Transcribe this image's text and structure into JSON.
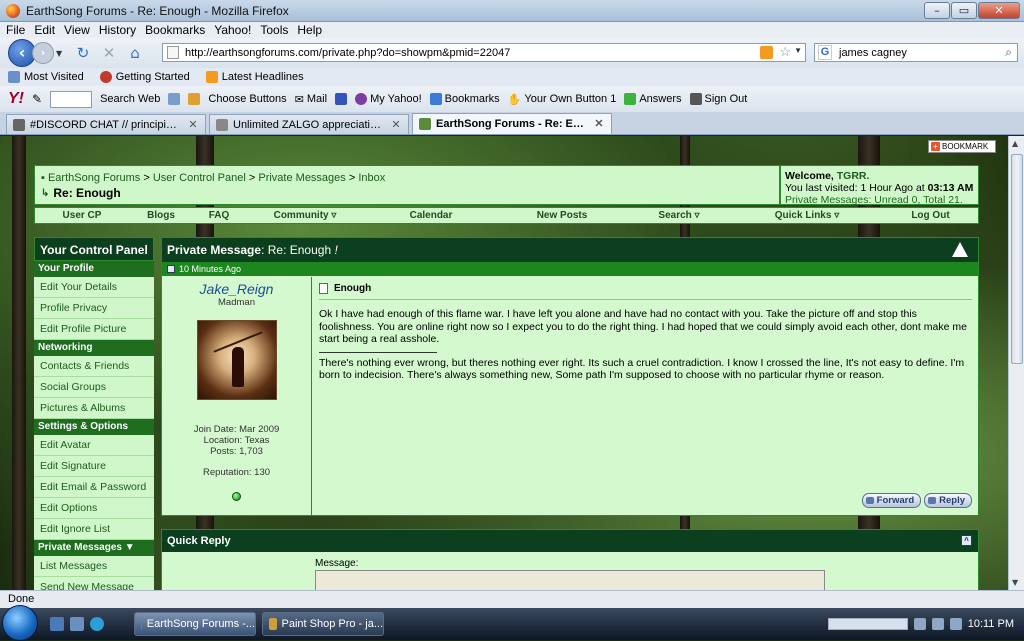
{
  "window": {
    "title": "EarthSong Forums - Re: Enough - Mozilla Firefox"
  },
  "menu": [
    "File",
    "Edit",
    "View",
    "History",
    "Bookmarks",
    "Yahoo!",
    "Tools",
    "Help"
  ],
  "nav": {
    "url": "http://earthsongforums.com/private.php?do=showpm&pmid=22047",
    "search_value": "james cagney"
  },
  "bookmarks": [
    "Most Visited",
    "Getting Started",
    "Latest Headlines"
  ],
  "yahoo_toolbar": [
    "Search Web",
    "Choose Buttons",
    "Mail",
    "My Yahoo!",
    "Bookmarks",
    "Your Own Button 1",
    "Answers",
    "Sign Out"
  ],
  "tabs": [
    {
      "label": "#DISCORD CHAT // principiadiscor..."
    },
    {
      "label": "Unlimited ZALGO appreciation thre..."
    },
    {
      "label": "EarthSong Forums - Re: Enough"
    }
  ],
  "page": {
    "bookmark_btn": "BOOKMARK",
    "crumbs": [
      "EarthSong Forums",
      "User Control Panel",
      "Private Messages",
      "Inbox"
    ],
    "crumb_sep": ">",
    "page_title": "Re: Enough",
    "welcome": {
      "prefix": "Welcome,",
      "user": "TGRR.",
      "visited": "You last visited: 1 Hour Ago at",
      "visited_time": "03:13 AM",
      "pm": "Private Messages: Unread 0, Total 21."
    },
    "navlinks": [
      "User CP",
      "Blogs",
      "FAQ",
      "Community",
      "Calendar",
      "New Posts",
      "Search",
      "Quick Links",
      "Log Out"
    ],
    "sidebar": {
      "title": "Your Control Panel",
      "sections": [
        {
          "name": "Your Profile",
          "items": [
            "Edit Your Details",
            "Profile Privacy",
            "Edit Profile Picture"
          ]
        },
        {
          "name": "Networking",
          "items": [
            "Contacts & Friends",
            "Social Groups",
            "Pictures & Albums"
          ]
        },
        {
          "name": "Settings & Options",
          "items": [
            "Edit Avatar",
            "Edit Signature",
            "Edit Email & Password",
            "Edit Options",
            "Edit Ignore List"
          ]
        },
        {
          "name": "Private Messages",
          "items": [
            "List Messages",
            "Send New Message"
          ]
        }
      ]
    },
    "message": {
      "header_prefix": "Private Message",
      "header_subject": "Re: Enough",
      "date": "10 Minutes Ago",
      "username": "Jake_Reign",
      "user_title": "Madman",
      "join_date": "Join Date: Mar 2009",
      "location": "Location: Texas",
      "posts": "Posts: 1,703",
      "reputation": "Reputation: 130",
      "subject": "Enough",
      "body": "Ok I have had enough of this flame war. I have left you alone and have had no contact with you. Take the picture off and stop this foolishness. You are online right now so I expect you to do the right thing. I had hoped that we could simply avoid each other, dont make me start being a real asshole.",
      "signature": "There's nothing ever wrong, but theres nothing ever right. Its such a cruel contradiction. I know I crossed the line, It's not easy to define. I'm born to indecision. There's always something new, Some path I'm supposed to choose with no particular rhyme or reason.",
      "forward_label": "Forward",
      "reply_label": "Reply"
    },
    "quick_reply": {
      "title": "Quick Reply",
      "label": "Message:"
    }
  },
  "status": "Done",
  "taskbar": {
    "tasks": [
      "EarthSong Forums -...",
      "Paint Shop Pro - ja..."
    ],
    "time": "10:11 PM"
  }
}
